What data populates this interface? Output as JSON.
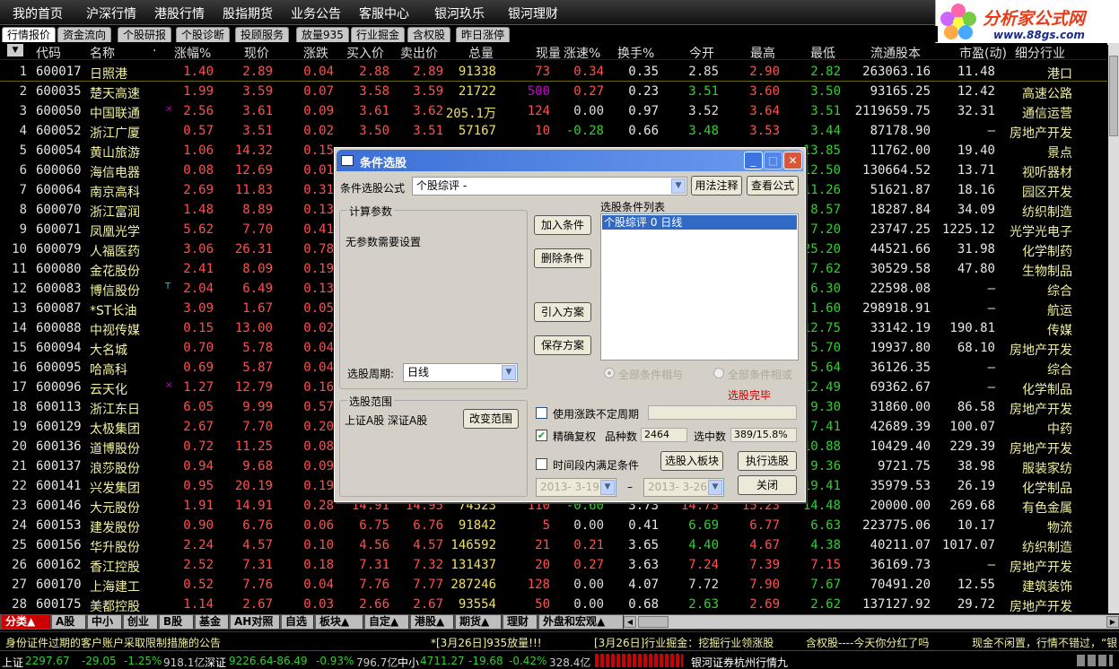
{
  "menu": [
    "我的首页",
    "沪深行情",
    "港股行情",
    "股指期货",
    "业务公告",
    "客服中心",
    "银河玖乐",
    "银河理财"
  ],
  "logo": {
    "brand": "分析家公式网",
    "url": "www.88gs.com"
  },
  "subtabs": [
    "行情报价",
    "资金流向",
    "个股研报",
    "个股诊断",
    "投顾服务",
    "放量935",
    "行业掘金",
    "含权股",
    "昨日涨停"
  ],
  "headers": [
    "代码",
    "名称",
    "·",
    "涨幅%",
    "现价",
    "涨跌",
    "买入价",
    "卖出价",
    "总量",
    "现量",
    "涨速%",
    "换手%",
    "今开",
    "最高",
    "最低",
    "流通股本",
    "市盈(动)",
    "细分行业"
  ],
  "rows": [
    [
      "1",
      "600017",
      "日照港",
      "",
      "1.40",
      "2.89",
      "0.04",
      "2.88",
      "2.89",
      "91338",
      "73",
      "0.34",
      "0.35",
      "2.85",
      "2.90",
      "2.82",
      "263063.16",
      "11.48",
      "港口"
    ],
    [
      "2",
      "600035",
      "楚天高速",
      "",
      "1.99",
      "3.59",
      "0.07",
      "3.58",
      "3.59",
      "21722",
      "500",
      "0.27",
      "0.23",
      "3.51",
      "3.60",
      "3.50",
      "93165.25",
      "12.42",
      "高速公路"
    ],
    [
      "3",
      "600050",
      "中国联通",
      "×",
      "2.56",
      "3.61",
      "0.09",
      "3.61",
      "3.62",
      "205.1万",
      "124",
      "0.00",
      "0.97",
      "3.52",
      "3.64",
      "3.51",
      "2119659.75",
      "32.31",
      "通信运营"
    ],
    [
      "4",
      "600052",
      "浙江广厦",
      "",
      "0.57",
      "3.51",
      "0.02",
      "3.50",
      "3.51",
      "57167",
      "10",
      "-0.28",
      "0.66",
      "3.48",
      "3.53",
      "3.44",
      "87178.90",
      "–",
      "房地产开发"
    ],
    [
      "5",
      "600054",
      "黄山旅游",
      "",
      "1.06",
      "14.32",
      "0.15",
      "",
      "",
      "",
      "",
      "",
      "",
      "",
      "",
      "13.85",
      "11762.00",
      "19.40",
      "景点"
    ],
    [
      "6",
      "600060",
      "海信电器",
      "",
      "0.08",
      "12.69",
      "0.01",
      "",
      "",
      "",
      "",
      "",
      "",
      "",
      "",
      "12.50",
      "130664.52",
      "13.71",
      "视听器材"
    ],
    [
      "7",
      "600064",
      "南京高科",
      "",
      "2.69",
      "11.83",
      "0.31",
      "",
      "",
      "",
      "",
      "",
      "",
      "",
      "",
      "11.26",
      "51621.87",
      "18.16",
      "园区开发"
    ],
    [
      "8",
      "600070",
      "浙江富润",
      "",
      "1.48",
      "8.89",
      "0.13",
      "",
      "",
      "",
      "",
      "",
      "",
      "",
      "",
      "8.57",
      "18287.84",
      "34.09",
      "纺织制造"
    ],
    [
      "9",
      "600071",
      "凤凰光学",
      "",
      "5.62",
      "7.70",
      "0.41",
      "",
      "",
      "",
      "",
      "",
      "",
      "",
      "",
      "7.20",
      "23747.25",
      "1225.12",
      "光学光电子"
    ],
    [
      "10",
      "600079",
      "人福医药",
      "",
      "3.06",
      "26.31",
      "0.78",
      "",
      "",
      "",
      "",
      "",
      "",
      "",
      "",
      "25.20",
      "44521.66",
      "31.98",
      "化学制药"
    ],
    [
      "11",
      "600080",
      "金花股份",
      "",
      "2.41",
      "8.09",
      "0.19",
      "",
      "",
      "",
      "",
      "",
      "",
      "",
      "",
      "7.62",
      "30529.58",
      "47.80",
      "生物制品"
    ],
    [
      "12",
      "600083",
      "博信股份",
      "T",
      "2.04",
      "6.49",
      "0.13",
      "",
      "",
      "",
      "",
      "",
      "",
      "",
      "",
      "6.30",
      "22598.08",
      "–",
      "综合"
    ],
    [
      "13",
      "600087",
      "*ST长油",
      "",
      "3.09",
      "1.67",
      "0.05",
      "",
      "",
      "",
      "",
      "",
      "",
      "",
      "",
      "1.60",
      "298918.91",
      "–",
      "航运"
    ],
    [
      "14",
      "600088",
      "中视传媒",
      "",
      "0.15",
      "13.00",
      "0.02",
      "",
      "",
      "",
      "",
      "",
      "",
      "",
      "",
      "12.75",
      "33142.19",
      "190.81",
      "传媒"
    ],
    [
      "15",
      "600094",
      "大名城",
      "",
      "0.70",
      "5.78",
      "0.04",
      "",
      "",
      "",
      "",
      "",
      "",
      "",
      "",
      "5.70",
      "19937.80",
      "68.10",
      "房地产开发"
    ],
    [
      "16",
      "600095",
      "哈高科",
      "",
      "0.69",
      "5.87",
      "0.04",
      "",
      "",
      "",
      "",
      "",
      "",
      "",
      "",
      "5.64",
      "36126.35",
      "–",
      "综合"
    ],
    [
      "17",
      "600096",
      "云天化",
      "×",
      "1.27",
      "12.79",
      "0.16",
      "",
      "",
      "",
      "",
      "",
      "",
      "",
      "",
      "12.49",
      "69362.67",
      "–",
      "化学制品"
    ],
    [
      "18",
      "600113",
      "浙江东日",
      "",
      "6.05",
      "9.99",
      "0.57",
      "",
      "",
      "",
      "",
      "",
      "",
      "",
      "",
      "9.30",
      "31860.00",
      "86.58",
      "房地产开发"
    ],
    [
      "19",
      "600129",
      "太极集团",
      "",
      "2.67",
      "7.70",
      "0.20",
      "",
      "",
      "",
      "",
      "",
      "",
      "",
      "",
      "7.41",
      "42689.39",
      "100.07",
      "中药"
    ],
    [
      "20",
      "600136",
      "道博股份",
      "",
      "0.72",
      "11.25",
      "0.08",
      "",
      "",
      "",
      "",
      "",
      "",
      "",
      "",
      "10.88",
      "10429.40",
      "229.39",
      "房地产开发"
    ],
    [
      "21",
      "600137",
      "浪莎股份",
      "",
      "0.94",
      "9.68",
      "0.09",
      "",
      "",
      "",
      "",
      "",
      "",
      "",
      "",
      "9.36",
      "9721.75",
      "38.98",
      "服装家纺"
    ],
    [
      "22",
      "600141",
      "兴发集团",
      "",
      "0.95",
      "20.19",
      "0.19",
      "",
      "",
      "",
      "",
      "",
      "",
      "",
      "",
      "19.41",
      "35979.53",
      "26.19",
      "化学制品"
    ],
    [
      "23",
      "600146",
      "大元股份",
      "",
      "1.91",
      "14.91",
      "0.28",
      "14.91",
      "14.95",
      "74523",
      "110",
      "-0.60",
      "3.73",
      "14.73",
      "15.23",
      "14.48",
      "20000.00",
      "269.68",
      "有色金属"
    ],
    [
      "24",
      "600153",
      "建发股份",
      "",
      "0.90",
      "6.76",
      "0.06",
      "6.75",
      "6.76",
      "91842",
      "5",
      "0.00",
      "0.41",
      "6.69",
      "6.77",
      "6.63",
      "223775.06",
      "10.17",
      "物流"
    ],
    [
      "25",
      "600156",
      "华升股份",
      "",
      "2.24",
      "4.57",
      "0.10",
      "4.56",
      "4.57",
      "146592",
      "21",
      "0.21",
      "3.65",
      "4.40",
      "4.67",
      "4.38",
      "40211.07",
      "1017.07",
      "纺织制造"
    ],
    [
      "26",
      "600162",
      "香江控股",
      "",
      "2.52",
      "7.31",
      "0.18",
      "7.31",
      "7.32",
      "131437",
      "20",
      "0.27",
      "3.63",
      "7.24",
      "7.39",
      "7.15",
      "36169.73",
      "–",
      "房地产开发"
    ],
    [
      "27",
      "600170",
      "上海建工",
      "",
      "0.52",
      "7.76",
      "0.04",
      "7.76",
      "7.77",
      "287246",
      "128",
      "0.00",
      "4.07",
      "7.72",
      "7.90",
      "7.67",
      "70491.20",
      "12.55",
      "建筑装饰"
    ],
    [
      "28",
      "600175",
      "美都控股",
      "",
      "1.14",
      "2.67",
      "0.03",
      "2.66",
      "2.67",
      "93554",
      "50",
      "0.00",
      "0.68",
      "2.63",
      "2.69",
      "2.62",
      "137127.92",
      "29.72",
      "房地产开发"
    ]
  ],
  "bottom_tabs": [
    "分类▲",
    "A股",
    "中小",
    "创业",
    "B股",
    "基金",
    "AH对照",
    "自选",
    "板块▲",
    "自定▲",
    "港股▲",
    "期货▲",
    "理财",
    "外盘和宏观▲"
  ],
  "ticker": [
    "身份证件过期的客户账户采取限制措施的公告",
    "*[3月26日]935放量!!!",
    "[3月26日]行业掘金：挖掘行业领涨股",
    "含权股----今天你分红了吗",
    "现金不闲置，行情不错过，“银"
  ],
  "status": {
    "sh_label": "上证",
    "sh_val": "2297.67",
    "sh_chg": "-29.05",
    "sh_pct": "-1.25%",
    "sh_amt": "918.1亿",
    "sz_label": "深证",
    "sz_val": "9226.64",
    "sz_chg": "-86.49",
    "sz_pct": "-0.93%",
    "sz_amt": "796.7亿",
    "zx_label": "中小",
    "zx_val": "4711.27",
    "zx_chg": "-19.68",
    "zx_pct": "-0.42%",
    "zx_amt": "328.4亿",
    "broker": "银河证券杭州行情九"
  },
  "dialog": {
    "title": "条件选股",
    "formula_label": "条件选股公式",
    "formula_value": "个股综评 -",
    "btn_usage": "用法注释",
    "btn_view": "查看公式",
    "params_group": "计算参数",
    "params_text": "无参数需要设置",
    "period_label": "选股周期:",
    "period_value": "日线",
    "btn_add": "加入条件",
    "btn_delete": "删除条件",
    "btn_import": "引入方案",
    "btn_save": "保存方案",
    "cond_list_label": "选股条件列表",
    "cond_item": "个股综评  0  日线",
    "radio_and": "全部条件相与",
    "radio_or": "全部条件相或",
    "status_done": "选股完毕",
    "range_group": "选股范围",
    "range_text": "上证A股 深证A股",
    "btn_range": "改变范围",
    "chk_period": "使用涨跌不定周期",
    "chk_adjust": "精确复权",
    "count_label": "品种数",
    "count_value": "2464",
    "selected_label": "选中数",
    "selected_value": "389/15.8%",
    "chk_interval": "时间段内满足条件",
    "btn_to_block": "选股入板块",
    "btn_run": "执行选股",
    "date_from": "2013- 3-19",
    "date_to": "2013- 3-26",
    "dash": "–",
    "btn_close": "关闭"
  },
  "colors": {
    "up": "#ff5050",
    "down": "#30d030",
    "code": "#e8e8e8",
    "name": "#f0f0a0",
    "vol": "#f0e060",
    "blue": "#7070ff"
  }
}
